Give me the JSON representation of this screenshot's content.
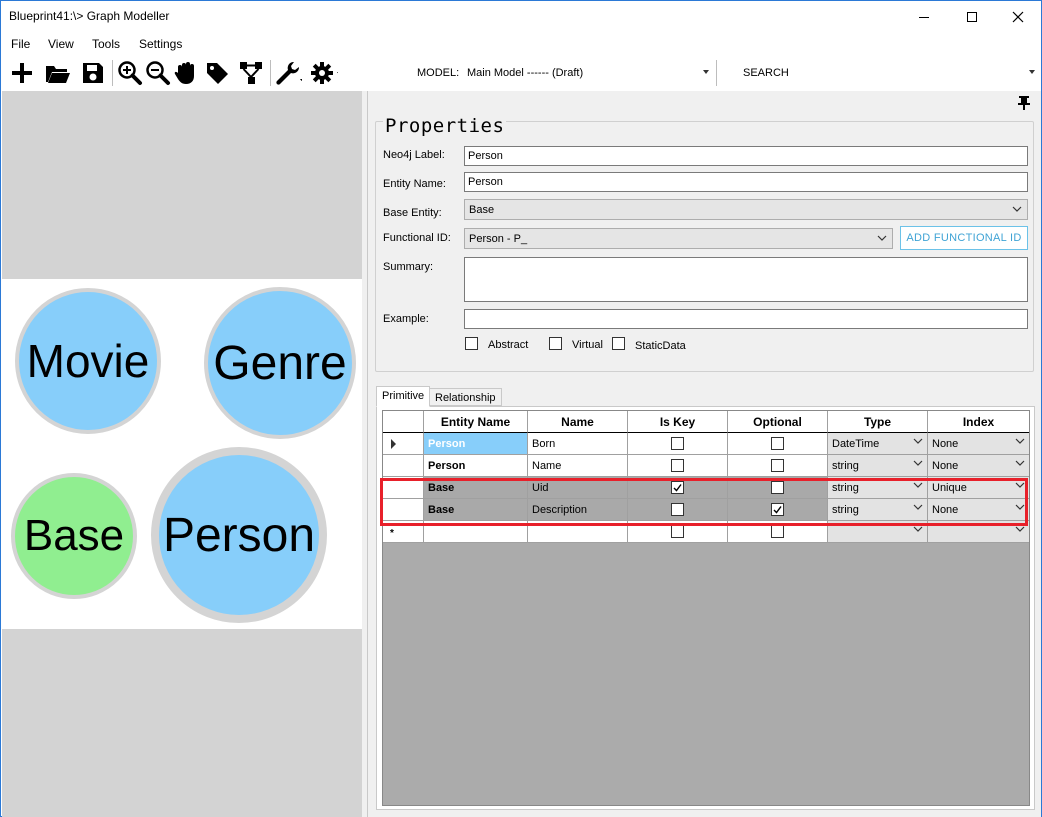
{
  "window": {
    "title": "Blueprint41:\\> Graph Modeller"
  },
  "menu": {
    "items": [
      "File",
      "View",
      "Tools",
      "Settings"
    ]
  },
  "toolbar": {
    "model_label": "MODEL:",
    "model_value": "Main Model ------ (Draft)",
    "search_label": "SEARCH",
    "icons": [
      "add-icon",
      "open-folder-icon",
      "save-icon",
      "zoom-in-icon",
      "zoom-out-icon",
      "pan-hand-icon",
      "tag-icon",
      "hierarchy-icon",
      "wrench-icon",
      "settings-gear-icon"
    ]
  },
  "canvas": {
    "nodes": [
      {
        "label": "Movie",
        "color": "#87cefa"
      },
      {
        "label": "Genre",
        "color": "#87cefa"
      },
      {
        "label": "Base",
        "color": "#90ee90"
      },
      {
        "label": "Person",
        "color": "#87cefa"
      }
    ]
  },
  "properties": {
    "title": "Properties",
    "neo4j_label": {
      "label": "Neo4j Label:",
      "value": "Person"
    },
    "entity_name": {
      "label": "Entity Name:",
      "value": "Person"
    },
    "base_entity": {
      "label": "Base Entity:",
      "value": "Base"
    },
    "functional_id": {
      "label": "Functional ID:",
      "value": "Person - P_"
    },
    "add_functional_id_button": "ADD FUNCTIONAL ID",
    "summary": {
      "label": "Summary:",
      "value": ""
    },
    "example": {
      "label": "Example:",
      "value": ""
    },
    "checkboxes": [
      {
        "label": "Abstract",
        "checked": false
      },
      {
        "label": "Virtual",
        "checked": false
      },
      {
        "label": "StaticData",
        "checked": false
      }
    ]
  },
  "tabs": [
    {
      "label": "Primitive",
      "active": true
    },
    {
      "label": "Relationship",
      "active": false
    }
  ],
  "grid": {
    "columns": [
      "Entity Name",
      "Name",
      "Is Key",
      "Optional",
      "Type",
      "Index"
    ],
    "rows": [
      {
        "entity": "Person",
        "name": "Born",
        "is_key": false,
        "optional": false,
        "type": "DateTime",
        "index": "None",
        "current": true
      },
      {
        "entity": "Person",
        "name": "Name",
        "is_key": false,
        "optional": false,
        "type": "string",
        "index": "None",
        "current": false
      },
      {
        "entity": "Base",
        "name": "Uid",
        "is_key": true,
        "optional": false,
        "type": "string",
        "index": "Unique",
        "current": false
      },
      {
        "entity": "Base",
        "name": "Description",
        "is_key": false,
        "optional": true,
        "type": "string",
        "index": "None",
        "current": false
      }
    ],
    "new_row_marker": "*",
    "highlight_color": "#e8202a"
  }
}
